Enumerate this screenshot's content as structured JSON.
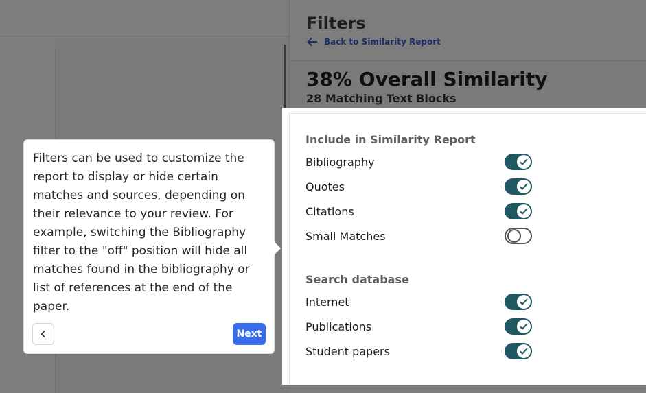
{
  "panel": {
    "title": "Filters",
    "back_label": "Back to Similarity Report",
    "similarity_title": "38% Overall Similarity",
    "similarity_sub": "28 Matching Text Blocks"
  },
  "filters": {
    "include_title": "Include in Similarity Report",
    "include_items": [
      {
        "label": "Bibliography",
        "on": true
      },
      {
        "label": "Quotes",
        "on": true
      },
      {
        "label": "Citations",
        "on": true
      },
      {
        "label": "Small Matches",
        "on": false
      }
    ],
    "search_title": "Search database",
    "search_items": [
      {
        "label": "Internet",
        "on": true
      },
      {
        "label": "Publications",
        "on": true
      },
      {
        "label": "Student papers",
        "on": true
      }
    ]
  },
  "tooltip": {
    "text": "Filters can be used to customize the report to display or hide certain matches and sources, depending on their relevance to your review. For example, switching the Bibliography filter to the \"off\" position will hide all matches found in the bibliography or list of references at the end of the paper.",
    "next_label": "Next"
  },
  "colors": {
    "toggle_on": "#1f5860",
    "next_button": "#3a6ee8"
  }
}
